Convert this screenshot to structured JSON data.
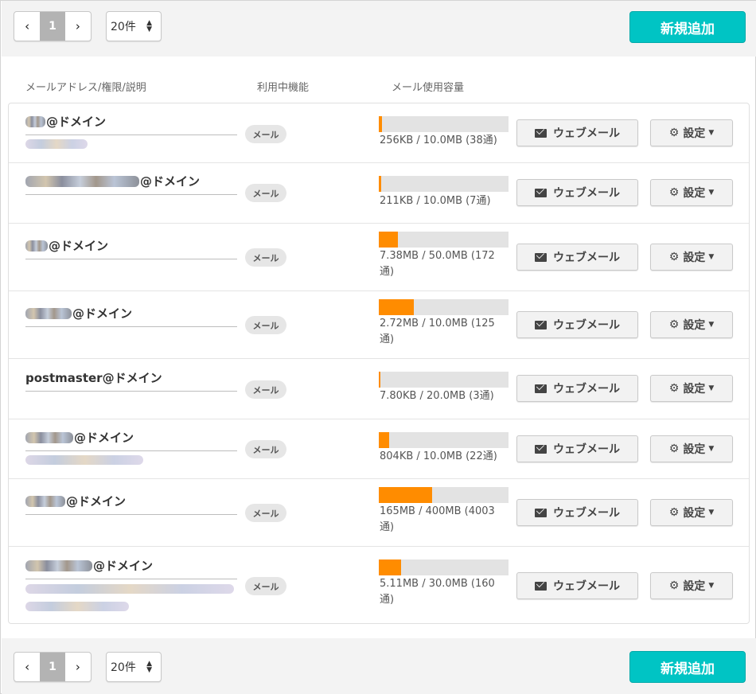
{
  "pagination": {
    "prev_icon": "chevron-left-icon",
    "next_icon": "chevron-right-icon",
    "prev_glyph": "‹",
    "next_glyph": "›",
    "current_page": "1",
    "per_page": "20件",
    "per_page_caret": "▲▼"
  },
  "add_button": "新規追加",
  "columns": {
    "address": "メールアドレス/権限/説明",
    "features": "利用中機能",
    "usage": "メール使用容量"
  },
  "accent_color": "#00c4c4",
  "bar_color": "#ff8c00",
  "rows": [
    {
      "address": "@ドメイン",
      "feature": "メール",
      "usage_text": "256KB / 10.0MB (38通)",
      "usage_fraction": 0.025,
      "webmail_label": "ウェブメール",
      "settings_label": "設定"
    },
    {
      "address": "@ドメイン",
      "feature": "メール",
      "usage_text": "211KB / 10.0MB (7通)",
      "usage_fraction": 0.021,
      "webmail_label": "ウェブメール",
      "settings_label": "設定"
    },
    {
      "address": "@ドメイン",
      "feature": "メール",
      "usage_text": "7.38MB / 50.0MB (172通)",
      "usage_fraction": 0.148,
      "webmail_label": "ウェブメール",
      "settings_label": "設定"
    },
    {
      "address": "@ドメイン",
      "feature": "メール",
      "usage_text": "2.72MB / 10.0MB (125通)",
      "usage_fraction": 0.272,
      "webmail_label": "ウェブメール",
      "settings_label": "設定"
    },
    {
      "address": "postmaster@ドメイン",
      "feature": "メール",
      "usage_text": "7.80KB / 20.0MB (3通)",
      "usage_fraction": 0.0004,
      "webmail_label": "ウェブメール",
      "settings_label": "設定"
    },
    {
      "address": "@ドメイン",
      "feature": "メール",
      "usage_text": "804KB / 10.0MB (22通)",
      "usage_fraction": 0.08,
      "webmail_label": "ウェブメール",
      "settings_label": "設定"
    },
    {
      "address": "@ドメイン",
      "feature": "メール",
      "usage_text": "165MB / 400MB (4003通)",
      "usage_fraction": 0.4125,
      "webmail_label": "ウェブメール",
      "settings_label": "設定"
    },
    {
      "address": "@ドメイン",
      "feature": "メール",
      "usage_text": "5.11MB / 30.0MB (160通)",
      "usage_fraction": 0.17,
      "webmail_label": "ウェブメール",
      "settings_label": "設定"
    }
  ],
  "icons": {
    "webmail": "envelope-icon",
    "settings": "gear-icon",
    "settings_caret": "chevron-down-icon",
    "gear_glyph": "⚙",
    "chevron_glyph": "▼"
  }
}
